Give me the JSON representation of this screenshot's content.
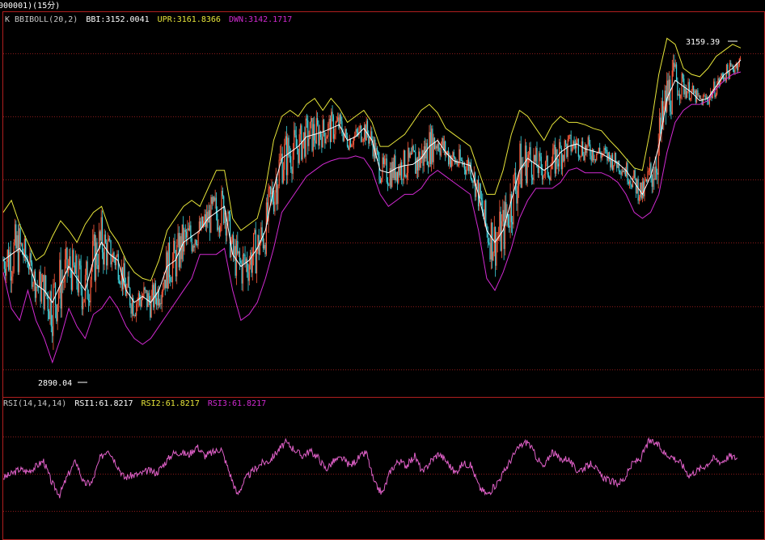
{
  "header": {
    "title_prefix": "000001)",
    "period": "(15分)"
  },
  "main_panel": {
    "indicator_name": "K  BBIBOLL(20,2)",
    "bbi_label": "BBI:3152.0041",
    "upr_label": "UPR:3161.8366",
    "dwn_label": "DWN:3142.1717",
    "high_label": "3159.39",
    "low_label": "2890.04"
  },
  "rsi_panel": {
    "indicator_name": "RSI(14,14,14)",
    "rsi1_label": "RSI1:61.8217",
    "rsi2_label": "RSI2:61.8217",
    "rsi3_label": "RSI3:61.8217"
  },
  "colors": {
    "background": "#000000",
    "frame": "#b01e1e",
    "grid": "#8a1a1a",
    "up_candle": "#ff5a3c",
    "down_candle": "#3fd6e0",
    "bbi": "#ffffff",
    "upr": "#e8e63a",
    "dwn": "#d22ad2",
    "rsi": "#e060c8",
    "text": "#ffffff"
  },
  "chart_data": [
    {
      "type": "candlestick",
      "title": "BBIBOLL(20,2)",
      "ylim": [
        2880,
        3175
      ],
      "series": [
        {
          "name": "BBI",
          "x": [
            0,
            10,
            20,
            30,
            40,
            50,
            60,
            70,
            80,
            90,
            100,
            110,
            120,
            130,
            140,
            150,
            160,
            170,
            180,
            190,
            200,
            210,
            220,
            230,
            240,
            250,
            260,
            270,
            280,
            290,
            300,
            310,
            320,
            330,
            340,
            350,
            360,
            370,
            380,
            390,
            400,
            410,
            420,
            430,
            440,
            450,
            460,
            470,
            480,
            490,
            500,
            510,
            520,
            530,
            540,
            550,
            560,
            570,
            580,
            590,
            600,
            610,
            620,
            630,
            640,
            650,
            660,
            670,
            680,
            690,
            700,
            710,
            720,
            730,
            740,
            750,
            760,
            770,
            780,
            790,
            800,
            810,
            820,
            830,
            840,
            850,
            860,
            870,
            880,
            890,
            900
          ],
          "values": [
            2985,
            2990,
            2995,
            2985,
            2965,
            2960,
            2950,
            2965,
            2980,
            2970,
            2960,
            2985,
            3000,
            2990,
            2985,
            2960,
            2950,
            2955,
            2950,
            2960,
            2980,
            2985,
            3000,
            3005,
            3010,
            3020,
            3025,
            3030,
            2990,
            2980,
            2985,
            2995,
            3010,
            3045,
            3070,
            3075,
            3080,
            3088,
            3090,
            3092,
            3095,
            3098,
            3085,
            3088,
            3095,
            3085,
            3060,
            3058,
            3062,
            3064,
            3065,
            3070,
            3080,
            3085,
            3075,
            3068,
            3066,
            3064,
            3040,
            3010,
            3000,
            3010,
            3035,
            3060,
            3070,
            3065,
            3060,
            3065,
            3075,
            3080,
            3082,
            3078,
            3076,
            3074,
            3070,
            3066,
            3060,
            3050,
            3040,
            3055,
            3080,
            3120,
            3135,
            3130,
            3125,
            3118,
            3120,
            3130,
            3140,
            3145,
            3152
          ]
        },
        {
          "name": "UPR",
          "values": [
            3025,
            3035,
            3015,
            3000,
            2985,
            2990,
            3005,
            3018,
            3010,
            3000,
            3015,
            3025,
            3030,
            3010,
            3000,
            2985,
            2975,
            2970,
            2968,
            2985,
            3010,
            3020,
            3030,
            3035,
            3030,
            3045,
            3060,
            3060,
            3020,
            3010,
            3015,
            3020,
            3045,
            3085,
            3105,
            3110,
            3105,
            3115,
            3120,
            3110,
            3120,
            3112,
            3100,
            3105,
            3110,
            3100,
            3080,
            3080,
            3085,
            3090,
            3100,
            3110,
            3115,
            3108,
            3095,
            3090,
            3085,
            3080,
            3060,
            3040,
            3040,
            3060,
            3090,
            3110,
            3105,
            3095,
            3085,
            3098,
            3105,
            3100,
            3100,
            3098,
            3095,
            3093,
            3085,
            3078,
            3070,
            3062,
            3060,
            3095,
            3140,
            3170,
            3165,
            3145,
            3140,
            3138,
            3145,
            3155,
            3160,
            3165,
            3162
          ]
        },
        {
          "name": "DWN",
          "values": [
            2975,
            2945,
            2935,
            2960,
            2935,
            2920,
            2900,
            2920,
            2945,
            2930,
            2920,
            2940,
            2945,
            2955,
            2945,
            2930,
            2920,
            2915,
            2920,
            2930,
            2940,
            2950,
            2960,
            2970,
            2990,
            2990,
            2990,
            2995,
            2960,
            2935,
            2940,
            2950,
            2970,
            2995,
            3025,
            3035,
            3045,
            3055,
            3060,
            3065,
            3068,
            3070,
            3070,
            3072,
            3070,
            3060,
            3040,
            3030,
            3035,
            3040,
            3040,
            3045,
            3055,
            3060,
            3055,
            3050,
            3045,
            3040,
            3010,
            2970,
            2960,
            2975,
            2995,
            3020,
            3035,
            3045,
            3045,
            3045,
            3050,
            3060,
            3062,
            3058,
            3058,
            3058,
            3055,
            3050,
            3040,
            3025,
            3020,
            3025,
            3040,
            3075,
            3100,
            3110,
            3115,
            3115,
            3118,
            3128,
            3135,
            3140,
            3142
          ]
        }
      ],
      "annotations": [
        {
          "text": "3159.39",
          "kind": "high"
        },
        {
          "text": "2890.04",
          "kind": "low"
        }
      ]
    },
    {
      "type": "line",
      "title": "RSI(14,14,14)",
      "ylim": [
        0,
        100
      ],
      "series": [
        {
          "name": "RSI1",
          "x": [
            0,
            10,
            20,
            30,
            40,
            50,
            60,
            70,
            80,
            90,
            100,
            110,
            120,
            130,
            140,
            150,
            160,
            170,
            180,
            190,
            200,
            210,
            220,
            230,
            240,
            250,
            260,
            270,
            280,
            290,
            300,
            310,
            320,
            330,
            340,
            350,
            360,
            370,
            380,
            390,
            400,
            410,
            420,
            430,
            440,
            450,
            460,
            470,
            480,
            490,
            500,
            510,
            520,
            530,
            540,
            550,
            560,
            570,
            580,
            590,
            600,
            610,
            620,
            630,
            640,
            650,
            660,
            670,
            680,
            690,
            700,
            710,
            720,
            730,
            740,
            750,
            760,
            770,
            780,
            790,
            800,
            810,
            820,
            830,
            840,
            850,
            860,
            870,
            880,
            890,
            900,
            910
          ],
          "values": [
            46,
            49,
            53,
            51,
            55,
            60,
            42,
            32,
            48,
            60,
            41,
            42,
            62,
            70,
            58,
            46,
            48,
            49,
            52,
            50,
            58,
            66,
            67,
            65,
            72,
            64,
            67,
            70,
            51,
            32,
            45,
            52,
            58,
            60,
            68,
            75,
            70,
            64,
            68,
            63,
            53,
            60,
            62,
            56,
            62,
            67,
            41,
            33,
            52,
            60,
            56,
            64,
            50,
            60,
            66,
            59,
            50,
            58,
            56,
            38,
            32,
            40,
            50,
            62,
            72,
            76,
            64,
            54,
            68,
            61,
            62,
            52,
            54,
            58,
            48,
            44,
            41,
            45,
            58,
            62,
            76,
            74,
            66,
            63,
            58,
            48,
            52,
            56,
            62,
            59,
            64,
            62
          ]
        }
      ]
    }
  ]
}
